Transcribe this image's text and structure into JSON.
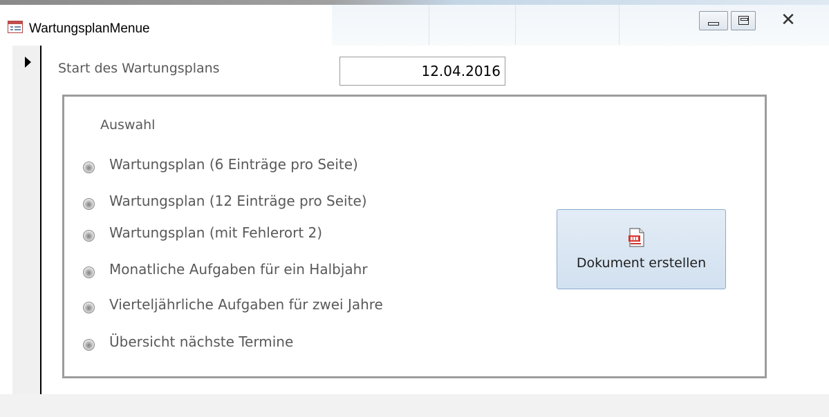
{
  "window": {
    "title": "WartungsplanMenue",
    "icon": "form-icon",
    "controls": {
      "minimize": "minimize-icon",
      "restore": "restore-icon",
      "close": "close-icon"
    }
  },
  "form": {
    "start_label": "Start des Wartungsplans",
    "start_date": "12.04.2016",
    "group": {
      "label": "Auswahl",
      "options": [
        {
          "label": "Wartungsplan (6 Einträge pro Seite)"
        },
        {
          "label": "Wartungsplan (12 Einträge pro Seite)"
        },
        {
          "label": "Wartungsplan (mit Fehlerort 2)"
        },
        {
          "label": "Monatliche Aufgaben für ein Halbjahr"
        },
        {
          "label": "Vierteljährliche Aufgaben für zwei Jahre"
        },
        {
          "label": "Übersicht nächste Termine"
        }
      ]
    },
    "create_button": {
      "label": "Dokument erstellen",
      "icon": "pdf-icon"
    }
  },
  "colors": {
    "label_text": "#595959",
    "group_border": "#9c9c9c",
    "button_fill": "#d9e6f3",
    "button_border": "#8aaacc",
    "pdf_red": "#d9322b"
  }
}
